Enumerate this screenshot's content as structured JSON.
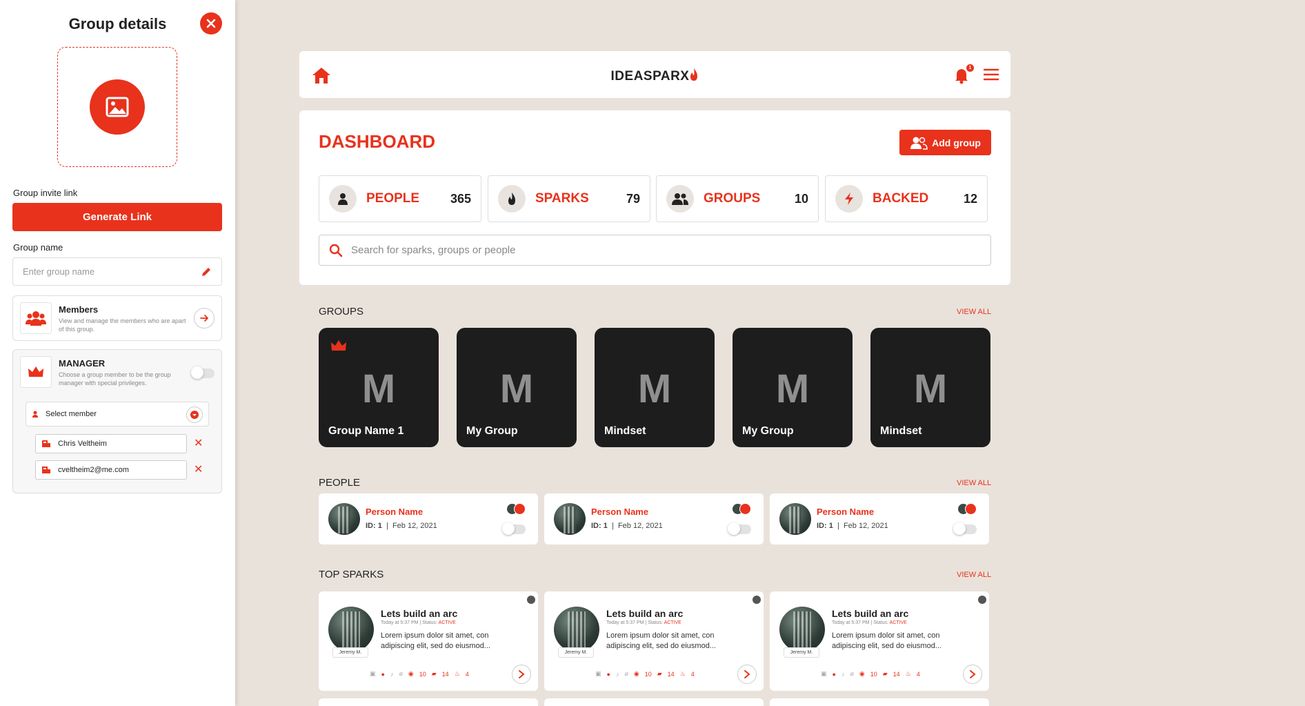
{
  "sidebar": {
    "title": "Group details",
    "invite_label": "Group invite link",
    "generate_label": "Generate Link",
    "name_label": "Group name",
    "name_placeholder": "Enter group name",
    "members": {
      "title": "Members",
      "desc": "View and manage the members who are apart of this group."
    },
    "manager": {
      "title": "MANAGER",
      "desc": "Choose a group member to be the group manager with special privileges.",
      "select_placeholder": "Select member",
      "selected": [
        "Chris Veltheim",
        "cveltheim2@me.com"
      ]
    }
  },
  "header": {
    "logo": "IDEASPARX",
    "notifications": "1"
  },
  "dashboard": {
    "title": "DASHBOARD",
    "add_group_label": "Add group",
    "stats": [
      {
        "label": "PEOPLE",
        "value": "365",
        "icon": "person-icon"
      },
      {
        "label": "SPARKS",
        "value": "79",
        "icon": "flame-icon"
      },
      {
        "label": "GROUPS",
        "value": "10",
        "icon": "group-icon"
      },
      {
        "label": "BACKED",
        "value": "12",
        "icon": "bolt-icon"
      }
    ],
    "search_placeholder": "Search for sparks, groups or people"
  },
  "sections": {
    "groups": "GROUPS",
    "people": "PEOPLE",
    "top_sparks": "TOP SPARKS",
    "view_all": "VIEW ALL"
  },
  "groups": [
    {
      "letter": "M",
      "name": "Group Name 1",
      "crown": true
    },
    {
      "letter": "M",
      "name": "My Group"
    },
    {
      "letter": "M",
      "name": "Mindset"
    },
    {
      "letter": "M",
      "name": "My Group"
    },
    {
      "letter": "M",
      "name": "Mindset"
    }
  ],
  "people": [
    {
      "name": "Person Name",
      "id": "ID: 1",
      "date": "Feb 12, 2021"
    },
    {
      "name": "Person Name",
      "id": "ID: 1",
      "date": "Feb 12, 2021"
    },
    {
      "name": "Person Name",
      "id": "ID: 1",
      "date": "Feb 12, 2021"
    }
  ],
  "sparks": [
    {
      "title": "Lets build an arc",
      "time": "Today at 5:37 PM",
      "status_label": "Status:",
      "status": "ACTIVE",
      "body": "Lorem ipsum dolor sit amet, con adipiscing elit, sed do eiusmod...",
      "author": "Jeremy M.",
      "views": "10",
      "comments": "14",
      "sparks": "4"
    },
    {
      "title": "Lets build an arc",
      "time": "Today at 5:37 PM",
      "status_label": "Status:",
      "status": "ACTIVE",
      "body": "Lorem ipsum dolor sit amet, con adipiscing elit, sed do eiusmod...",
      "author": "Jeremy M.",
      "views": "10",
      "comments": "14",
      "sparks": "4"
    },
    {
      "title": "Lets build an arc",
      "time": "Today at 5:37 PM",
      "status_label": "Status:",
      "status": "ACTIVE",
      "body": "Lorem ipsum dolor sit amet, con adipiscing elit, sed do eiusmod...",
      "author": "Jeremy M.",
      "views": "10",
      "comments": "14",
      "sparks": "4"
    }
  ],
  "colors": {
    "accent": "#e8321c",
    "background": "#e9e2db",
    "card_dark": "#1e1d1d"
  }
}
